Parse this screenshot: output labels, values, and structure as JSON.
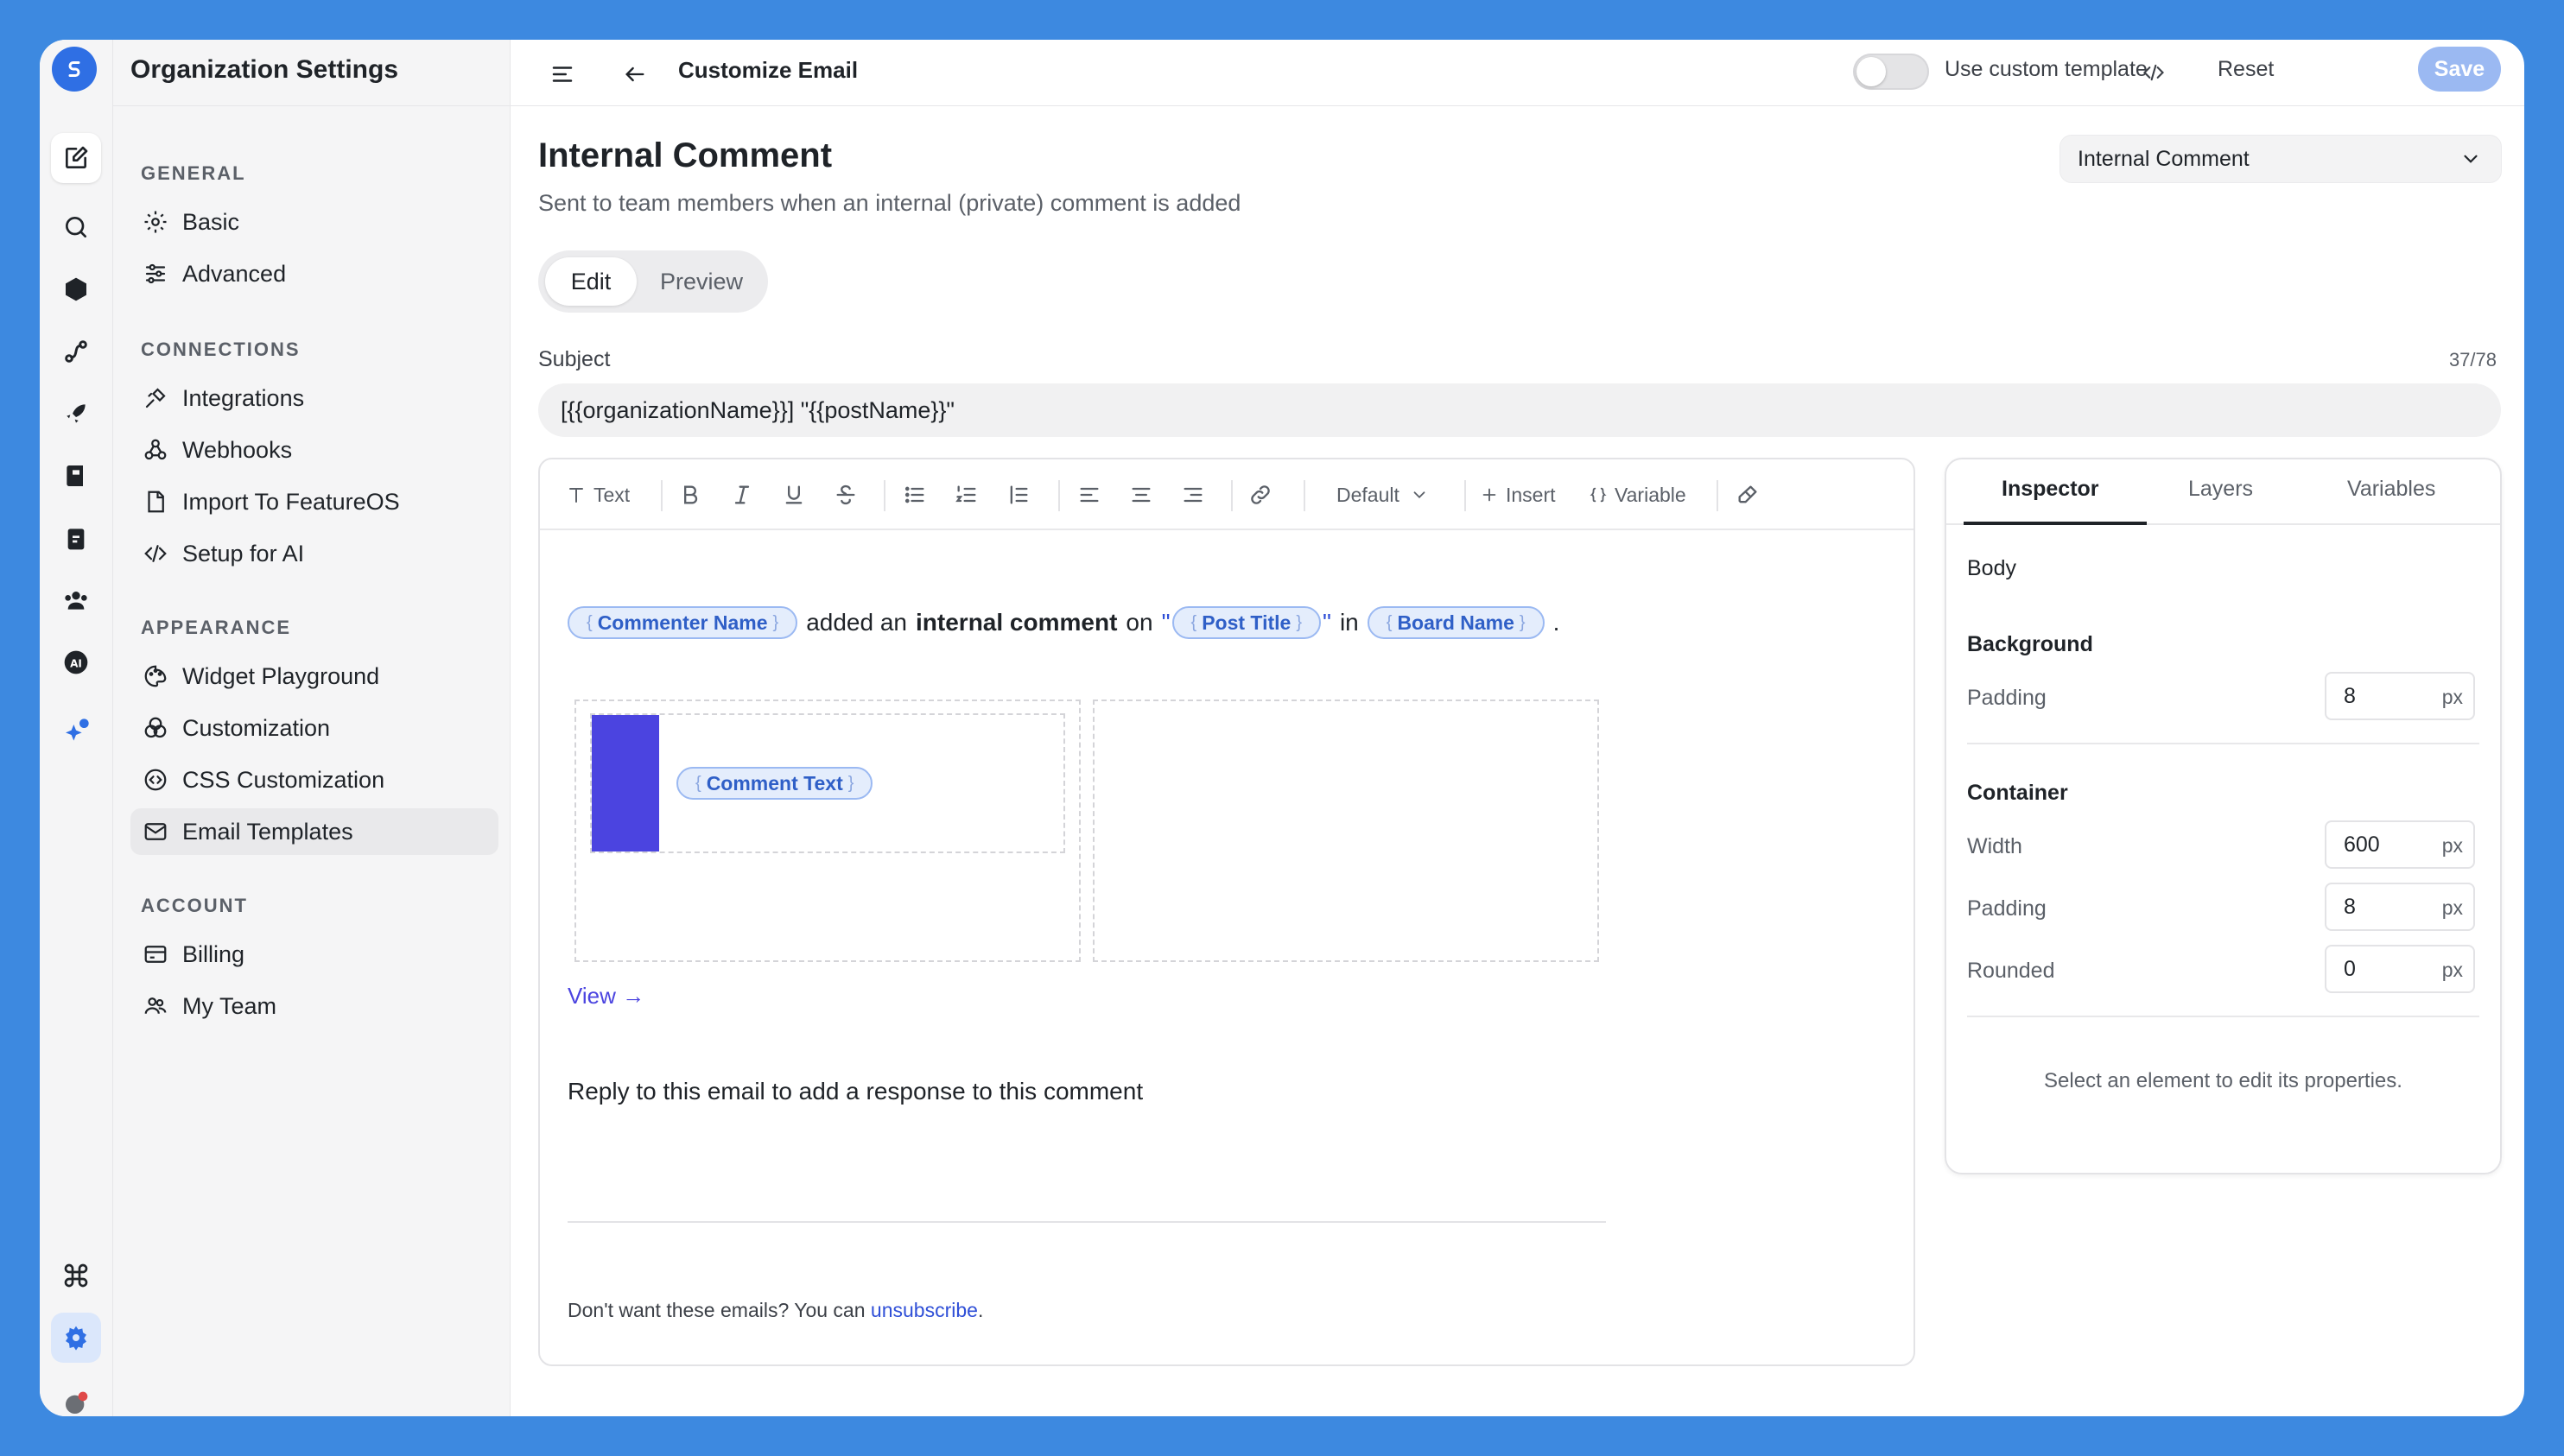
{
  "sidebar": {
    "org_title": "Organization Settings",
    "sections": [
      {
        "heading": "GENERAL",
        "items": [
          {
            "label": "Basic",
            "icon": "gear-icon"
          },
          {
            "label": "Advanced",
            "icon": "sliders-icon"
          }
        ]
      },
      {
        "heading": "CONNECTIONS",
        "items": [
          {
            "label": "Integrations",
            "icon": "plug-icon"
          },
          {
            "label": "Webhooks",
            "icon": "webhook-icon"
          },
          {
            "label": "Import To FeatureOS",
            "icon": "file-import-icon"
          },
          {
            "label": "Setup for AI",
            "icon": "code-icon"
          }
        ]
      },
      {
        "heading": "APPEARANCE",
        "items": [
          {
            "label": "Widget Playground",
            "icon": "palette-icon"
          },
          {
            "label": "Customization",
            "icon": "shapes-icon"
          },
          {
            "label": "CSS Customization",
            "icon": "css-icon"
          },
          {
            "label": "Email Templates",
            "icon": "mail-icon",
            "active": true
          }
        ]
      },
      {
        "heading": "ACCOUNT",
        "items": [
          {
            "label": "Billing",
            "icon": "credit-card-icon"
          },
          {
            "label": "My Team",
            "icon": "team-icon"
          }
        ]
      }
    ]
  },
  "topbar": {
    "title": "Customize Email",
    "toggle_label": "Use custom template",
    "toggle_on": false,
    "reset_label": "Reset",
    "save_label": "Save"
  },
  "page": {
    "title": "Internal Comment",
    "subtitle": "Sent to team members when an internal (private) comment is added",
    "template_select": "Internal Comment",
    "tabs": [
      "Edit",
      "Preview"
    ],
    "active_tab": "Edit"
  },
  "subject": {
    "label": "Subject",
    "count": "37/78",
    "value": "[{{organizationName}}] \"{{postName}}\""
  },
  "toolbar": {
    "text_label": "Text",
    "font_select": "Default",
    "insert_label": "Insert",
    "variable_label": "Variable"
  },
  "email": {
    "var_commenter": "Commenter Name",
    "text_added": "added an",
    "text_bold": "internal comment",
    "text_on": "on",
    "quote": "\"",
    "var_post": "Post Title",
    "text_in": "in",
    "var_board": "Board Name",
    "period": ".",
    "var_comment": "Comment Text",
    "accent_color": "#4b44e0",
    "view_link": "View →",
    "reply_text": "Reply to this email to add a response to this comment",
    "unsub_prefix": "Don't want these emails? You can",
    "unsub_link": "unsubscribe",
    "unsub_suffix": "."
  },
  "inspector": {
    "tabs": [
      "Inspector",
      "Layers",
      "Variables"
    ],
    "active_tab": "Inspector",
    "body_label": "Body",
    "background_heading": "Background",
    "bg_padding_label": "Padding",
    "bg_padding_value": "8",
    "container_heading": "Container",
    "width_label": "Width",
    "width_value": "600",
    "c_padding_label": "Padding",
    "c_padding_value": "8",
    "rounded_label": "Rounded",
    "rounded_value": "0",
    "unit": "px",
    "hint": "Select an element to edit its properties."
  }
}
